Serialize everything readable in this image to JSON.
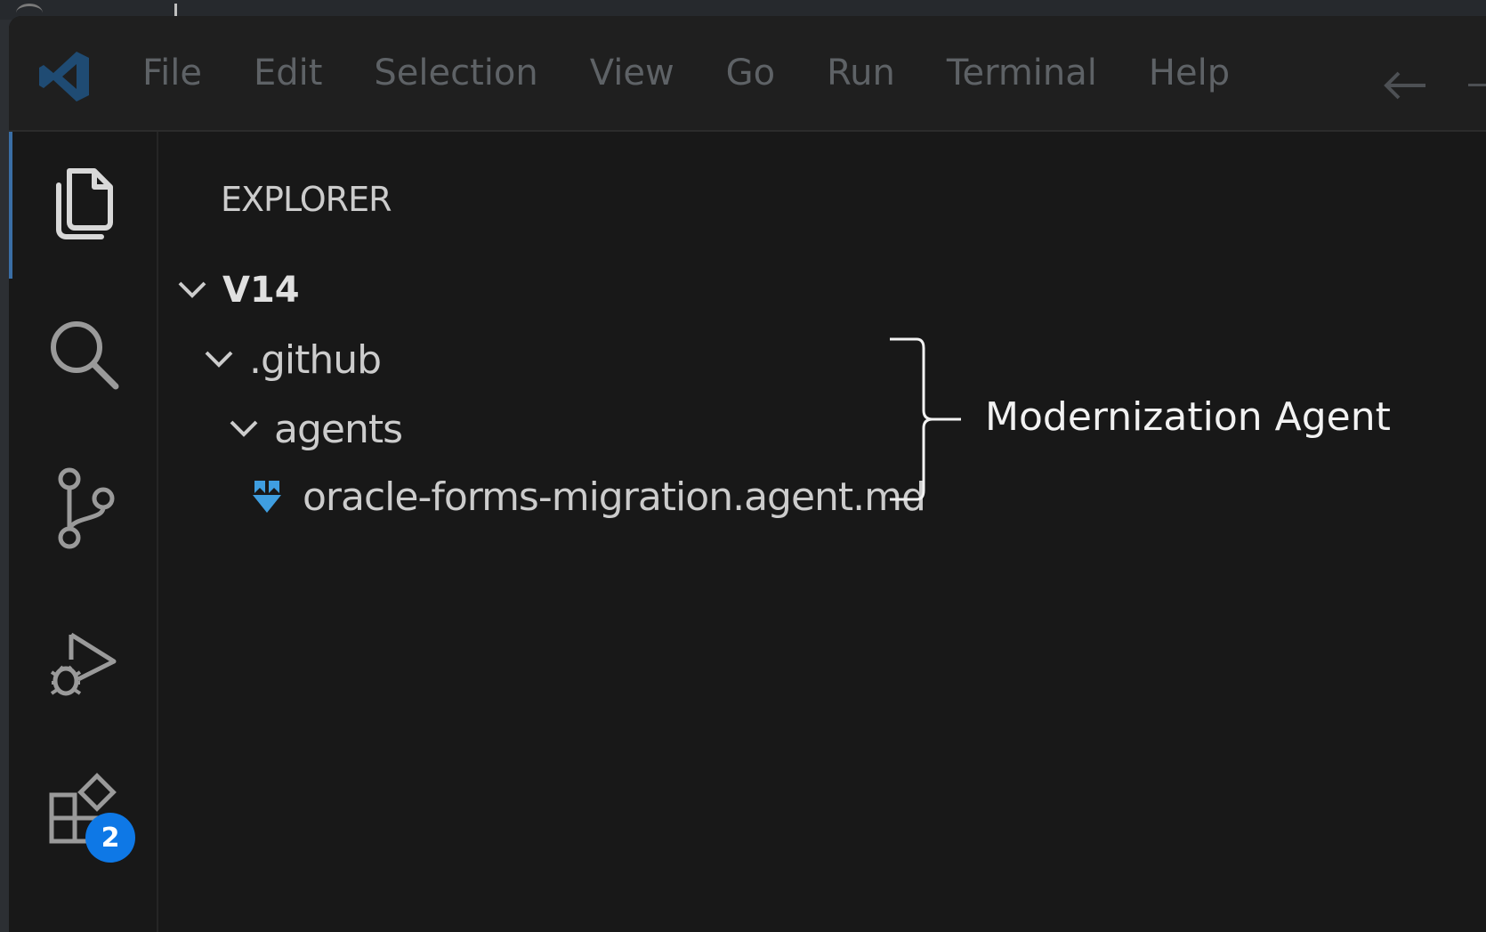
{
  "menu": {
    "items": [
      "File",
      "Edit",
      "Selection",
      "View",
      "Go",
      "Run",
      "Terminal",
      "Help"
    ]
  },
  "activity_bar": {
    "icons": [
      "explorer-icon",
      "search-icon",
      "source-control-icon",
      "run-debug-icon",
      "extensions-icon"
    ],
    "extensions_badge": "2"
  },
  "sidebar": {
    "title": "EXPLORER",
    "tree": {
      "root": "V14",
      "folder_github": ".github",
      "folder_agents": "agents",
      "file": "oracle-forms-migration.agent.md"
    }
  },
  "annotation": {
    "label": "Modernization Agent"
  },
  "colors": {
    "accent": "#0e78e6",
    "file_icon": "#3f9ee0",
    "menu_text": "#5e6266"
  }
}
